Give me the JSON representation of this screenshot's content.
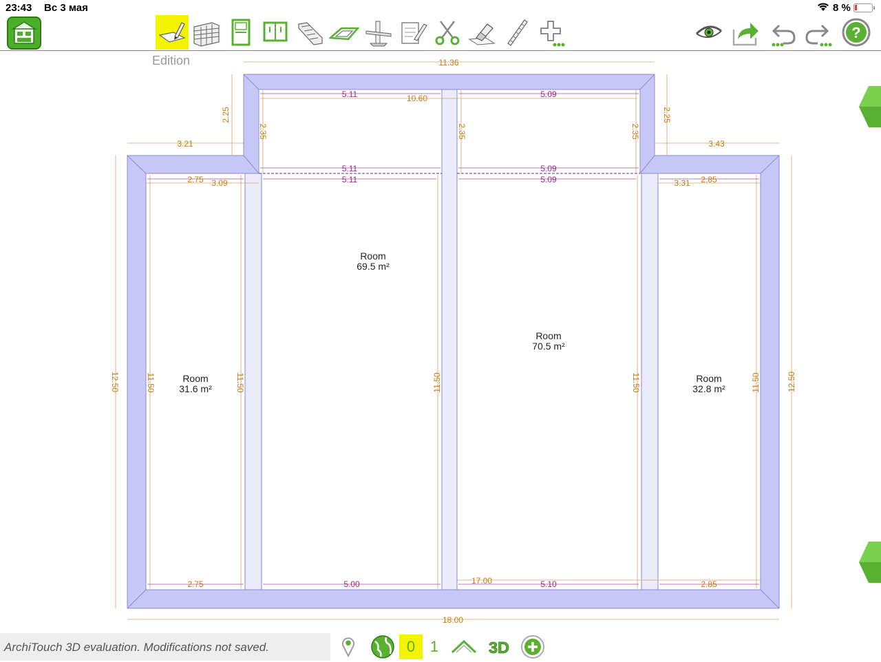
{
  "status_bar": {
    "time": "23:43",
    "date": "Вс 3 мая",
    "battery": "8 %"
  },
  "toolbar": {
    "tools": [
      {
        "name": "edit-tool",
        "icon": "pencil-ruler-icon",
        "active": true
      },
      {
        "name": "wall-tool",
        "icon": "brick-wall-icon"
      },
      {
        "name": "door-tool",
        "icon": "door-icon"
      },
      {
        "name": "window-tool",
        "icon": "window-icon"
      },
      {
        "name": "stairs-tool",
        "icon": "stairs-icon"
      },
      {
        "name": "slab-tool",
        "icon": "slab-icon"
      },
      {
        "name": "beam-tool",
        "icon": "beam-icon"
      },
      {
        "name": "note-tool",
        "icon": "note-pencil-icon"
      },
      {
        "name": "cut-tool",
        "icon": "scissors-icon"
      },
      {
        "name": "erase-tool",
        "icon": "eraser-icon"
      },
      {
        "name": "measure-tool",
        "icon": "ruler-icon"
      },
      {
        "name": "more-tools",
        "icon": "plus-more-icon"
      }
    ],
    "right": [
      {
        "name": "view",
        "icon": "eye-icon"
      },
      {
        "name": "share",
        "icon": "share-icon"
      },
      {
        "name": "undo",
        "icon": "undo-icon"
      },
      {
        "name": "redo",
        "icon": "redo-icon"
      },
      {
        "name": "help",
        "icon": "help-icon"
      }
    ]
  },
  "mode_label": "Edition",
  "rooms": [
    {
      "label": "Room",
      "area": "69.5 m²"
    },
    {
      "label": "Room",
      "area": "70.5 m²"
    },
    {
      "label": "Room",
      "area": "31.6 m²"
    },
    {
      "label": "Room",
      "area": "32.8 m²"
    }
  ],
  "dimensions": {
    "top_total": "11.36",
    "top_inner": "10.60",
    "alcove_left_top": "5.11",
    "alcove_right_top": "5.09",
    "alcove_left_bottom": "5.11",
    "alcove_right_bottom": "5.09",
    "room_left_top": "5.11",
    "room_right_top": "5.09",
    "left_step": "3.21",
    "right_step": "3.43",
    "alcove_left_h_outer": "2.25",
    "alcove_left_h_inner": "2.35",
    "alcove_mid_h": "2.35",
    "alcove_right_h_inner": "2.35",
    "alcove_right_h_outer": "2.25",
    "left_room_w_top": "2.75",
    "left_room_w_top2": "3.09",
    "right_room_w_top": "2.85",
    "right_room_w_top2": "3.31",
    "left_outer_h": "12.50",
    "right_outer_h": "12.50",
    "h_inner_1": "11.50",
    "h_inner_2": "11.50",
    "h_inner_3": "11.50",
    "h_inner_4": "11.50",
    "h_inner_5": "11.50",
    "bottom_1": "2.75",
    "bottom_2": "5.00",
    "bottom_3": "17.00",
    "bottom_4": "5.10",
    "bottom_5": "2.85",
    "bottom_total": "18.00"
  },
  "bottom_bar": {
    "status": "ArchiTouch 3D evaluation. Modifications not saved.",
    "floor_0": "0",
    "floor_1": "1",
    "view_3d": "3D"
  },
  "colors": {
    "wall": "#c8c8f8",
    "wall_stroke": "#8a8ad8",
    "dim_orange": "#c57a10",
    "dim_purple": "#9a2a86",
    "highlight": "#f4f400",
    "green": "#5ab030"
  }
}
